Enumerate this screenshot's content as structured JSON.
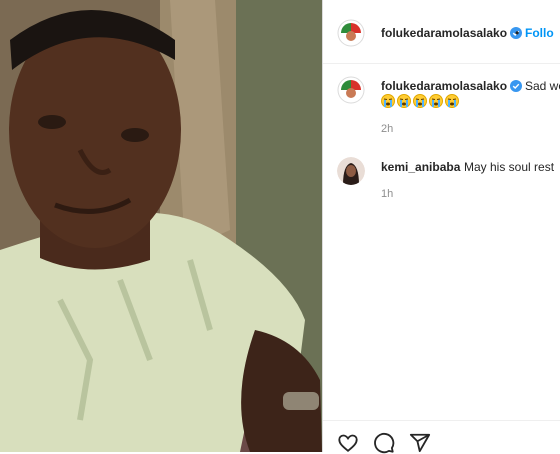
{
  "header": {
    "username": "folukedaramolasalako",
    "separator": "•",
    "follow_label": "Follo",
    "verified": true
  },
  "caption": {
    "username": "folukedaramolasalako",
    "text": "Sad we",
    "emoji_count": 5,
    "emoji_name": "loudly-crying-face",
    "time": "2h"
  },
  "comments": [
    {
      "username": "kemi_anibaba",
      "text": "May his soul rest",
      "time": "1h"
    }
  ],
  "actions": [
    "like-icon",
    "comment-icon",
    "share-icon"
  ],
  "colors": {
    "accent": "#0095f6",
    "verified": "#3897f0",
    "text": "#262626",
    "muted": "#8e8e8e",
    "border": "#dbdbdb"
  }
}
